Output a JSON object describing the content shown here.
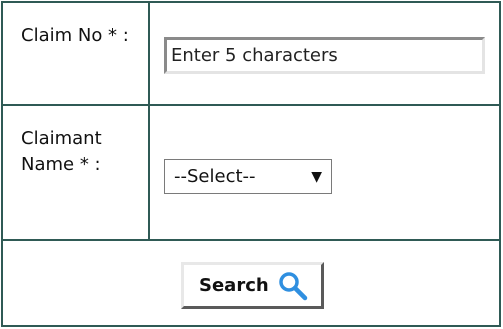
{
  "claim_row": {
    "label": "Claim No * :",
    "input_value": "",
    "input_placeholder": "Enter 5 characters"
  },
  "claimant_row": {
    "label": "Claimant Name * :",
    "select_value": "--Select--",
    "arrow": "▼"
  },
  "search_button": {
    "label": "Search",
    "icon": "magnifier-icon"
  },
  "colors": {
    "border": "#2f5a55",
    "icon": "#2f8fe0"
  }
}
